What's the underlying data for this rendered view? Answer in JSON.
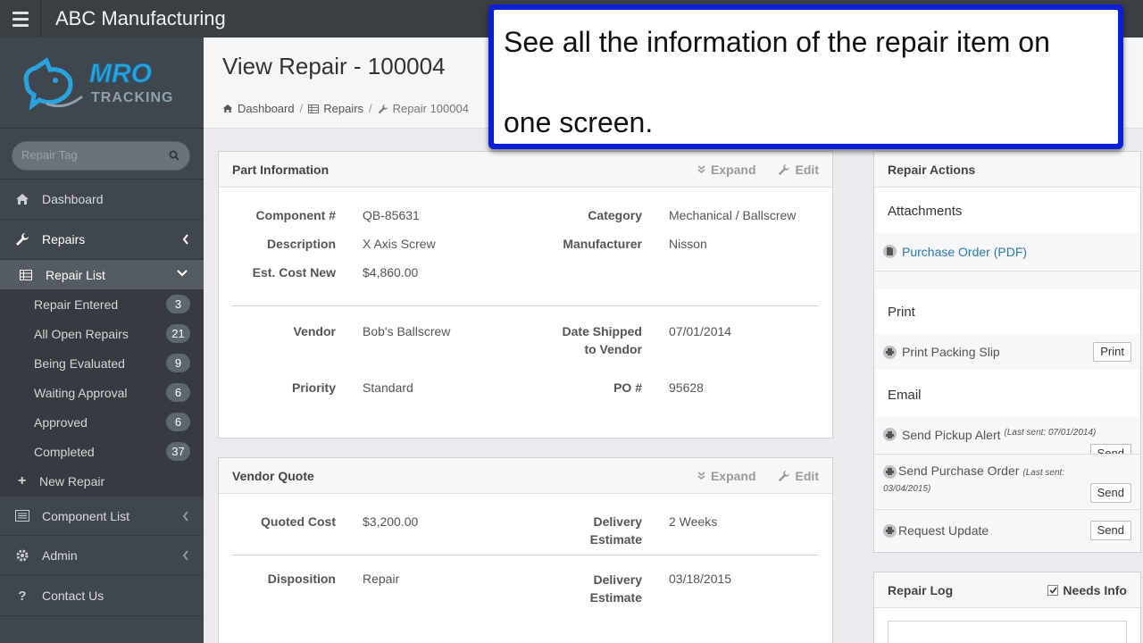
{
  "topbar": {
    "title": "ABC Manufacturing"
  },
  "sidebar": {
    "search_placeholder": "Repair Tag",
    "items": [
      {
        "label": "Dashboard"
      },
      {
        "label": "Repairs"
      },
      {
        "label": "Component List"
      },
      {
        "label": "Admin"
      },
      {
        "label": "Contact Us"
      }
    ],
    "repair_list": {
      "label": "Repair List",
      "entries": [
        {
          "label": "Repair Entered",
          "count": "3"
        },
        {
          "label": "All Open Repairs",
          "count": "21"
        },
        {
          "label": "Being Evaluated",
          "count": "9"
        },
        {
          "label": "Waiting Approval",
          "count": "6"
        },
        {
          "label": "Approved",
          "count": "6"
        },
        {
          "label": "Completed",
          "count": "37"
        }
      ],
      "new_repair": "New Repair"
    }
  },
  "header": {
    "title": "View Repair - 100004",
    "breadcrumb": [
      "Dashboard",
      "Repairs",
      "Repair 100004"
    ]
  },
  "part_info": {
    "title": "Part Information",
    "expand": "Expand",
    "edit": "Edit",
    "component_label": "Component #",
    "component": "QB-85631",
    "category_label": "Category",
    "category": "Mechanical / Ballscrew",
    "description_label": "Description",
    "description": "X Axis Screw",
    "manufacturer_label": "Manufacturer",
    "manufacturer": "Nisson",
    "cost_label": "Est. Cost New",
    "cost": "$4,860.00",
    "vendor_label": "Vendor",
    "vendor": "Bob's Ballscrew",
    "date_shipped_label_1": "Date Shipped",
    "date_shipped_label_2": "to Vendor",
    "date_shipped": "07/01/2014",
    "priority_label": "Priority",
    "priority": "Standard",
    "po_label": "PO #",
    "po": "95628"
  },
  "vendor_quote": {
    "title": "Vendor Quote",
    "expand": "Expand",
    "edit": "Edit",
    "quoted_label": "Quoted Cost",
    "quoted": "$3,200.00",
    "delivery_label_1": "Delivery",
    "delivery_label_2": "Estimate",
    "delivery": "2 Weeks",
    "disposition_label": "Disposition",
    "disposition": "Repair",
    "delivery2_label_1": "Delivery",
    "delivery2_label_2": "Estimate",
    "delivery2": "03/18/2015"
  },
  "repair_actions": {
    "title": "Repair Actions",
    "attachments": "Attachments",
    "purchase_order_link": "Purchase Order (PDF)",
    "print": "Print",
    "print_packing_slip": "Print Packing Slip",
    "print_button": "Print",
    "email": "Email",
    "send_pickup_alert": "Send Pickup Alert",
    "pickup_last_sent": "(Last sent: 07/01/2014)",
    "send_purchase_order": "Send Purchase Order",
    "po_last_sent_1": "(Last sent:",
    "po_last_sent_2": "03/04/2015)",
    "request_update": "Request Update",
    "send_button": "Send"
  },
  "repair_log": {
    "title": "Repair Log",
    "needs_info": "Needs Info"
  },
  "callout": {
    "line1": "See all the information of the repair item on",
    "line2": "one screen."
  },
  "colors": {
    "sidebar": "#3f464d",
    "topbar": "#3a3f44",
    "link": "#2a7ab0",
    "callout_border": "#0a1fd6"
  }
}
